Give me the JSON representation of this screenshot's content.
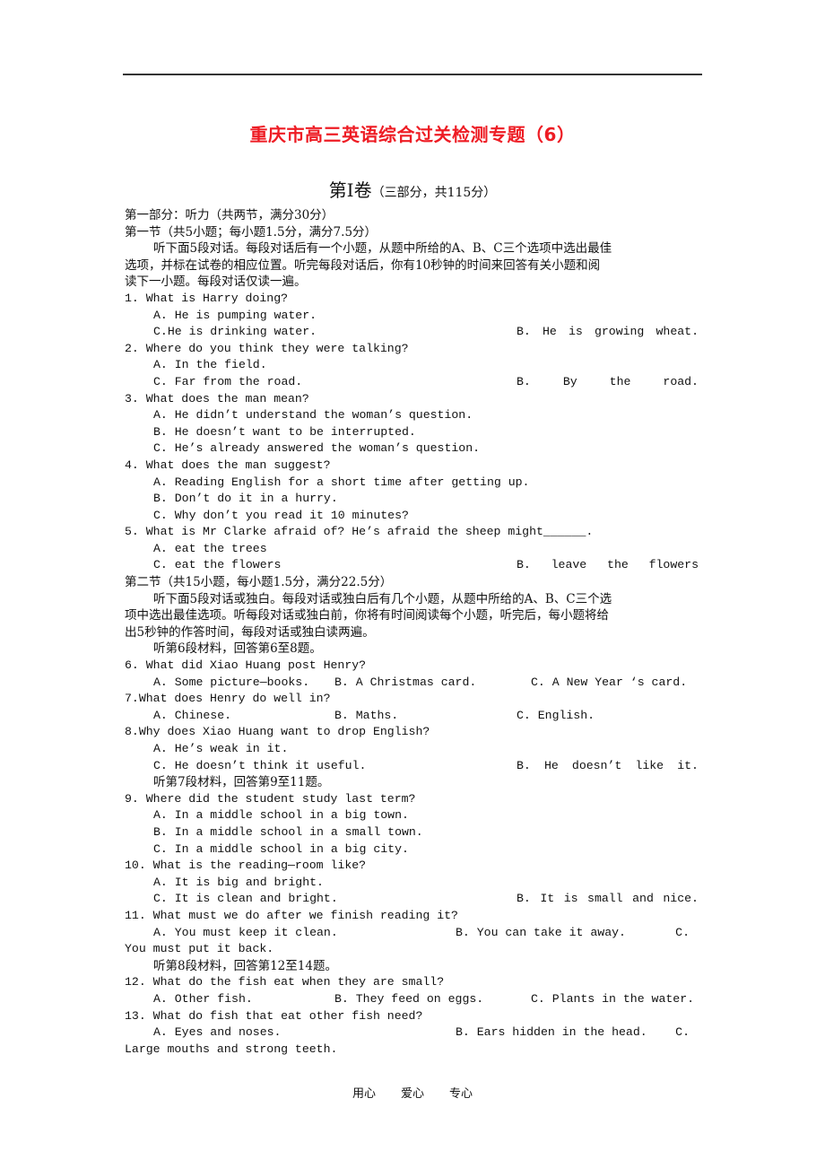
{
  "title": "重庆市高三英语综合过关检测专题（6）",
  "volume": {
    "main": "第Ⅰ卷",
    "note": "（三部分，共115分）"
  },
  "part1": {
    "heading": "第一部分：听力（共两节，满分30分）",
    "section1": {
      "heading": "第一节（共5小题；每小题1.5分，满分7.5分）",
      "instructions_1": "听下面5段对话。每段对话后有一个小题，从题中所给的A、B、C三个选项中选出最佳",
      "instructions_2": "选项，并标在试卷的相应位置。听完每段对话后，你有10秒钟的时间来回答有关小题和阅",
      "instructions_3": "读下一小题。每段对话仅读一遍。"
    },
    "section2": {
      "heading": "第二节（共15小题，每小题1.5分，满分22.5分）",
      "instructions_1": "听下面5段对话或独白。每段对话或独白后有几个小题，从题中所给的A、B、C三个选",
      "instructions_2": "项中选出最佳选项。听每段对话或独白前，你将有时间阅读每个小题，听完后，每小题将给",
      "instructions_3": "出5秒钟的作答时间，每段对话或独白读两遍。"
    },
    "material_notes": [
      "听第6段材料，回答第6至8题。",
      "听第7段材料，回答第9至11题。",
      "听第8段材料，回答第12至14题。"
    ]
  },
  "questions": [
    {
      "q": "1. What is Harry doing?",
      "a": "A. He is pumping water.",
      "b": [
        "B.",
        "He",
        "is",
        "growing",
        "wheat."
      ],
      "c": "C.He is drinking water."
    },
    {
      "q": "2. Where do you think they were talking?",
      "a": "A. In the field.",
      "b": [
        "B.",
        "By",
        "the",
        "road."
      ],
      "c": "C. Far from the road."
    },
    {
      "q": "3. What does the man mean?",
      "a": "A. He didn’t understand the woman’s question.",
      "b": "B. He doesn’t want to be interrupted.",
      "c": "C. He’s already answered the woman’s question."
    },
    {
      "q": "4. What does the man suggest?",
      "a": "A. Reading English for a short time after getting up.",
      "b": "B. Don’t do it in a hurry.",
      "c": "C. Why don’t you read it 10 minutes?"
    },
    {
      "q": "5. What is Mr Clarke afraid of? He’s afraid the sheep might______.",
      "a": "A. eat the trees",
      "b": [
        "B.",
        "leave",
        "the",
        "flowers"
      ],
      "c": "C. eat the flowers"
    },
    {
      "q": "6. What did Xiao Huang post Henry?",
      "a": "A. Some picture—books.",
      "b": "B. A Christmas card.",
      "c": "C. A New Year ‘s card."
    },
    {
      "q": "7.What does Henry do well in?",
      "a": "A. Chinese.",
      "b": "B. Maths.",
      "c": "C. English."
    },
    {
      "q": "8.Why does Xiao Huang want to drop English?",
      "a": "A. He’s weak in it.",
      "b": [
        "B.",
        "He",
        "doesn’t",
        "like",
        "it."
      ],
      "c": "C. He doesn’t think it useful."
    },
    {
      "q": "9. Where did the student study last term?",
      "a": "A. In a middle school in a big town.",
      "b": "B. In a middle school in a small town.",
      "c": "C. In a middle school in a big city."
    },
    {
      "q": "10. What is the reading—room like?",
      "a": "A. It is big and bright.",
      "b": [
        "B.",
        "It",
        "is",
        "small",
        "and",
        "nice."
      ],
      "c": "C. It is clean and bright."
    },
    {
      "q": "11. What must we do after we finish reading it?",
      "a": "A. You must keep it clean.",
      "b": "B. You can take it away.",
      "c_prefix": "C.",
      "c": "You must put it back."
    },
    {
      "q": "12. What do the fish eat when they are small?",
      "a": "A. Other fish.",
      "b": "B. They feed on eggs.",
      "c": "C. Plants in the water."
    },
    {
      "q": "13. What do fish that eat other fish need?",
      "a": "A. Eyes and noses.",
      "b": "B. Ears hidden in the head.",
      "c_prefix": "C.",
      "c": "Large mouths and strong teeth."
    }
  ],
  "footer": [
    "用心",
    "爱心",
    "专心"
  ]
}
